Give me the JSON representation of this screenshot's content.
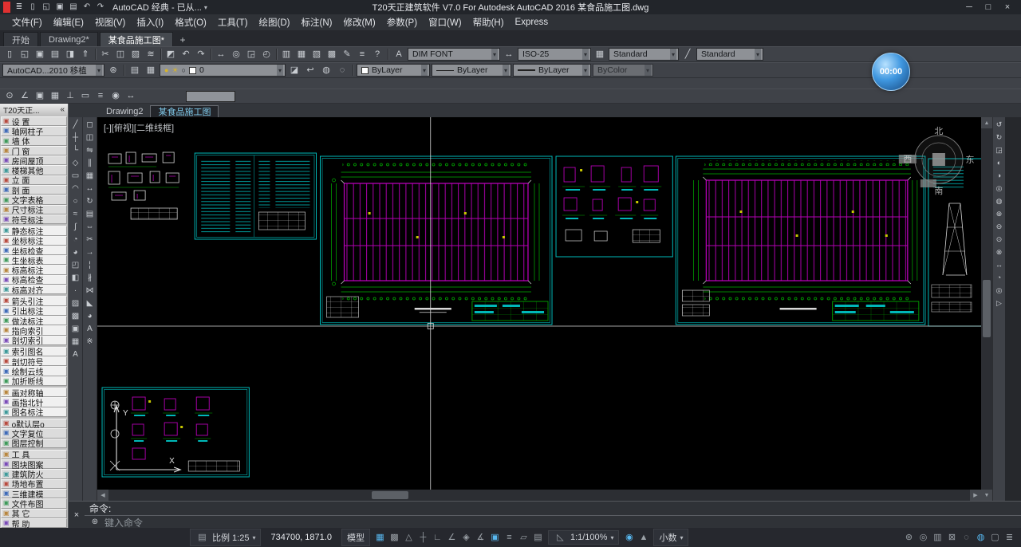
{
  "colors": {
    "cyan": "#00b8b8",
    "magenta": "#b400b4",
    "green": "#00b000",
    "yellow": "#c8c800",
    "status_on": "#58b8f0"
  },
  "titlebar": {
    "title": "T20天正建筑软件 V7.0 For Autodesk AutoCAD 2016   某食品施工图.dwg",
    "workspace_label": "AutoCAD 经典 - 已从...",
    "qat_icons": [
      "app-menu-icon",
      "new-icon",
      "open-icon",
      "save-icon",
      "print-icon",
      "undo-icon",
      "redo-icon"
    ],
    "window_icons": [
      "minimize-icon",
      "maximize-icon",
      "close-icon"
    ]
  },
  "menubar": {
    "items": [
      "文件(F)",
      "编辑(E)",
      "视图(V)",
      "插入(I)",
      "格式(O)",
      "工具(T)",
      "绘图(D)",
      "标注(N)",
      "修改(M)",
      "参数(P)",
      "窗口(W)",
      "帮助(H)",
      "Express"
    ]
  },
  "file_tabs": {
    "tabs": [
      {
        "label": "开始",
        "active": false
      },
      {
        "label": "Drawing2*",
        "active": false
      },
      {
        "label": "某食品施工图*",
        "active": true
      }
    ],
    "new_tab_label": "+"
  },
  "toolbar_standard": {
    "icons": [
      "new-icon",
      "open-icon",
      "save-icon",
      "plot-icon",
      "plot-preview-icon",
      "publish-icon",
      "cut-icon",
      "copy-icon",
      "paste-icon",
      "match-properties-icon",
      "block-editor-icon",
      "undo-icon",
      "redo-icon",
      "pan-icon",
      "zoom-realtime-icon",
      "zoom-window-icon",
      "zoom-previous-icon",
      "properties-icon",
      "designcenter-icon",
      "tool-palettes-icon",
      "sheet-set-manager-icon",
      "markup-icon",
      "quickcalc-icon",
      "help-icon"
    ],
    "text_style_combo": "DIM  FONT",
    "dim_style_combo": "ISO-25",
    "table_style_combo": "Standard",
    "mleader_style_combo": "Standard"
  },
  "toolbar_properties": {
    "workspace_combo": "AutoCAD...2010 移植",
    "layer_combo": "0",
    "color_combo": "ByLayer",
    "linetype_combo": "ByLayer",
    "lineweight_combo": "ByLayer",
    "plotstyle_combo": "ByColor"
  },
  "toolbar_small": {
    "icons": [
      "osnap-settings-icon",
      "polar-icon",
      "object-snap-icon",
      "grid-display-icon",
      "ucs-icon",
      "annotation-icon",
      "layer-walk-icon",
      "group-icon",
      "measure-icon"
    ]
  },
  "doc_tabs": {
    "tabs": [
      {
        "label": "Drawing2",
        "active": false
      },
      {
        "label": "某食品施工图",
        "active": true
      }
    ]
  },
  "palette": {
    "header": "T20天正...",
    "collapse_label": "«",
    "sections": [
      {
        "items": [
          {
            "icon": "settings-icon",
            "label": "设  置"
          },
          {
            "icon": "axis-grid-icon",
            "label": "轴网柱子"
          },
          {
            "icon": "wall-icon",
            "label": "墙  体"
          },
          {
            "icon": "door-window-icon",
            "label": "门  窗"
          },
          {
            "icon": "room-roof-icon",
            "label": "房间屋顶"
          },
          {
            "icon": "stair-icon",
            "label": "楼梯其他"
          },
          {
            "icon": "elevation-icon",
            "label": "立  面"
          },
          {
            "icon": "section-icon",
            "label": "剖  面"
          },
          {
            "icon": "text-table-icon",
            "label": "文字表格"
          },
          {
            "icon": "dimension-icon",
            "label": "尺寸标注"
          },
          {
            "icon": "symbol-icon",
            "label": "符号标注"
          }
        ]
      },
      {
        "items": [
          {
            "icon": "static-dim-icon",
            "label": "静态标注"
          },
          {
            "icon": "coord-dim-icon",
            "label": "坐标标注"
          },
          {
            "icon": "coord-check-icon",
            "label": "坐标检查"
          },
          {
            "icon": "coord-table-icon",
            "label": "生坐标表"
          },
          {
            "icon": "level-dim-icon",
            "label": "标高标注"
          },
          {
            "icon": "level-check-icon",
            "label": "标高检查"
          },
          {
            "icon": "level-align-icon",
            "label": "标高对齐"
          }
        ]
      },
      {
        "items": [
          {
            "icon": "arrow-leader-icon",
            "label": "箭头引注"
          },
          {
            "icon": "leader-icon",
            "label": "引出标注"
          },
          {
            "icon": "method-note-icon",
            "label": "做法标注"
          },
          {
            "icon": "point-index-icon",
            "label": "指向索引"
          },
          {
            "icon": "section-index-icon",
            "label": "剖切索引"
          }
        ]
      },
      {
        "items": [
          {
            "icon": "index-name-icon",
            "label": "索引图名"
          },
          {
            "icon": "section-symbol-icon",
            "label": "剖切符号"
          },
          {
            "icon": "revision-cloud-icon",
            "label": "绘制云线"
          },
          {
            "icon": "break-line-icon",
            "label": "加折断线"
          }
        ]
      },
      {
        "items": [
          {
            "icon": "symmetry-axis-icon",
            "label": "画对称轴"
          },
          {
            "icon": "north-arrow-icon",
            "label": "画指北针"
          },
          {
            "icon": "drawing-name-icon",
            "label": "图名标注"
          }
        ]
      },
      {
        "items": [
          {
            "icon": "default-layer-icon",
            "label": "o默认层o"
          },
          {
            "icon": "text-reset-icon",
            "label": "文字复位"
          },
          {
            "icon": "layer-control-icon",
            "label": "图层控制"
          }
        ]
      },
      {
        "items": [
          {
            "icon": "tools-icon",
            "label": "工  具"
          },
          {
            "icon": "block-pattern-icon",
            "label": "图块图案"
          },
          {
            "icon": "fire-protection-icon",
            "label": "建筑防火"
          },
          {
            "icon": "site-layout-icon",
            "label": "场地布置"
          },
          {
            "icon": "model-3d-icon",
            "label": "三维建模"
          },
          {
            "icon": "file-layout-icon",
            "label": "文件布图"
          },
          {
            "icon": "others-icon",
            "label": "其  它"
          },
          {
            "icon": "help-icon",
            "label": "帮  助"
          }
        ]
      }
    ]
  },
  "left_strip1": {
    "icons": [
      "line-icon",
      "xline-icon",
      "polyline-icon",
      "polygon-icon",
      "rectangle-icon",
      "arc-icon",
      "circle-icon",
      "revcloud-icon",
      "spline-icon",
      "ellipse-icon",
      "ellipse-arc-icon",
      "insert-block-icon",
      "make-block-icon",
      "point-icon",
      "hatch-icon",
      "gradient-icon",
      "region-icon",
      "table-icon",
      "mtext-icon"
    ]
  },
  "left_strip2": {
    "icons": [
      "erase-icon",
      "copy-icon",
      "mirror-icon",
      "offset-icon",
      "array-icon",
      "move-icon",
      "rotate-icon",
      "scale-icon",
      "stretch-icon",
      "trim-icon",
      "extend-icon",
      "break-point-icon",
      "break-icon",
      "join-icon",
      "chamfer-icon",
      "fillet-icon",
      "text-icon",
      "explode-icon"
    ]
  },
  "right_strip": {
    "icons": [
      "redraw-icon",
      "regen-icon",
      "zoom-window-icon",
      "zoom-dynamic-icon",
      "zoom-scale-icon",
      "zoom-center-icon",
      "zoom-object-icon",
      "zoom-in-icon",
      "zoom-out-icon",
      "zoom-all-icon",
      "zoom-extents-icon",
      "pan-icon",
      "orbit-icon",
      "steering-wheel-icon",
      "show-motion-icon"
    ]
  },
  "canvas": {
    "view_label": "[-][俯视][二维线框]",
    "compass": {
      "north": "北",
      "south": "南",
      "east": "东",
      "west": "西"
    },
    "ucs": {
      "x": "X",
      "y": "Y"
    }
  },
  "command": {
    "history_line": "命令:",
    "input_hint": "键入命令"
  },
  "statusbar": {
    "scale_label": "比例 1:25",
    "coordinates": "734700, 1871.0",
    "model_label": "模型",
    "annotation_scale_label": "1:1/100%",
    "units_label": "小数",
    "toggles": [
      {
        "icon": "grid-icon",
        "on": true
      },
      {
        "icon": "snap-icon",
        "on": false
      },
      {
        "icon": "infer-constraints-icon",
        "on": false
      },
      {
        "icon": "dynamic-input-icon",
        "on": false
      },
      {
        "icon": "ortho-icon",
        "on": false
      },
      {
        "icon": "polar-tracking-icon",
        "on": false
      },
      {
        "icon": "isodraft-icon",
        "on": false
      },
      {
        "icon": "object-snap-tracking-icon",
        "on": false
      },
      {
        "icon": "object-snap-icon",
        "on": true
      },
      {
        "icon": "lineweight-icon",
        "on": false
      },
      {
        "icon": "transparency-icon",
        "on": false
      },
      {
        "icon": "selection-cycling-icon",
        "on": false
      }
    ],
    "mid_toggles": [
      {
        "icon": "annotation-visibility-icon",
        "on": true
      },
      {
        "icon": "autoscale-icon",
        "on": false
      }
    ],
    "right_toggles": [
      {
        "icon": "workspace-switch-icon",
        "on": false
      },
      {
        "icon": "annotation-monitor-icon",
        "on": false
      },
      {
        "icon": "quick-properties-icon",
        "on": false
      },
      {
        "icon": "lock-ui-icon",
        "on": false
      },
      {
        "icon": "isolate-objects-icon",
        "on": false
      },
      {
        "icon": "graphics-performance-icon",
        "on": true
      },
      {
        "icon": "clean-screen-icon",
        "on": false
      },
      {
        "icon": "customize-icon",
        "on": false
      }
    ]
  },
  "overlay": {
    "timer": "00:00"
  }
}
